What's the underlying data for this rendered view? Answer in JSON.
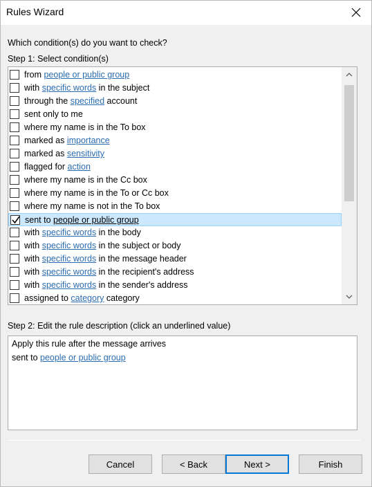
{
  "window": {
    "title": "Rules Wizard"
  },
  "question": "Which condition(s) do you want to check?",
  "step1_label": "Step 1: Select condition(s)",
  "conditions": [
    {
      "pre": "from ",
      "link": "people or public group",
      "post": "",
      "checked": false
    },
    {
      "pre": "with ",
      "link": "specific words",
      "post": " in the subject",
      "checked": false
    },
    {
      "pre": "through the ",
      "link": "specified",
      "post": " account",
      "checked": false
    },
    {
      "pre": "sent only to me",
      "link": "",
      "post": "",
      "checked": false
    },
    {
      "pre": "where my name is in the To box",
      "link": "",
      "post": "",
      "checked": false
    },
    {
      "pre": "marked as ",
      "link": "importance",
      "post": "",
      "checked": false
    },
    {
      "pre": "marked as ",
      "link": "sensitivity",
      "post": "",
      "checked": false
    },
    {
      "pre": "flagged for ",
      "link": "action",
      "post": "",
      "checked": false
    },
    {
      "pre": "where my name is in the Cc box",
      "link": "",
      "post": "",
      "checked": false
    },
    {
      "pre": "where my name is in the To or Cc box",
      "link": "",
      "post": "",
      "checked": false
    },
    {
      "pre": "where my name is not in the To box",
      "link": "",
      "post": "",
      "checked": false
    },
    {
      "pre": "sent to ",
      "link": "people or public group",
      "post": "",
      "checked": true
    },
    {
      "pre": "with ",
      "link": "specific words",
      "post": " in the body",
      "checked": false
    },
    {
      "pre": "with ",
      "link": "specific words",
      "post": " in the subject or body",
      "checked": false
    },
    {
      "pre": "with ",
      "link": "specific words",
      "post": " in the message header",
      "checked": false
    },
    {
      "pre": "with ",
      "link": "specific words",
      "post": " in the recipient's address",
      "checked": false
    },
    {
      "pre": "with ",
      "link": "specific words",
      "post": " in the sender's address",
      "checked": false
    },
    {
      "pre": "assigned to ",
      "link": "category",
      "post": " category",
      "checked": false
    }
  ],
  "step2_label": "Step 2: Edit the rule description (click an underlined value)",
  "description": {
    "line1": "Apply this rule after the message arrives",
    "line2_pre": "sent to ",
    "line2_link": "people or public group"
  },
  "buttons": {
    "cancel": "Cancel",
    "back": "< Back",
    "next": "Next >",
    "finish": "Finish"
  },
  "colors": {
    "link": "#2b6cb0",
    "selection": "#cce8ff",
    "accent": "#0078d7"
  }
}
